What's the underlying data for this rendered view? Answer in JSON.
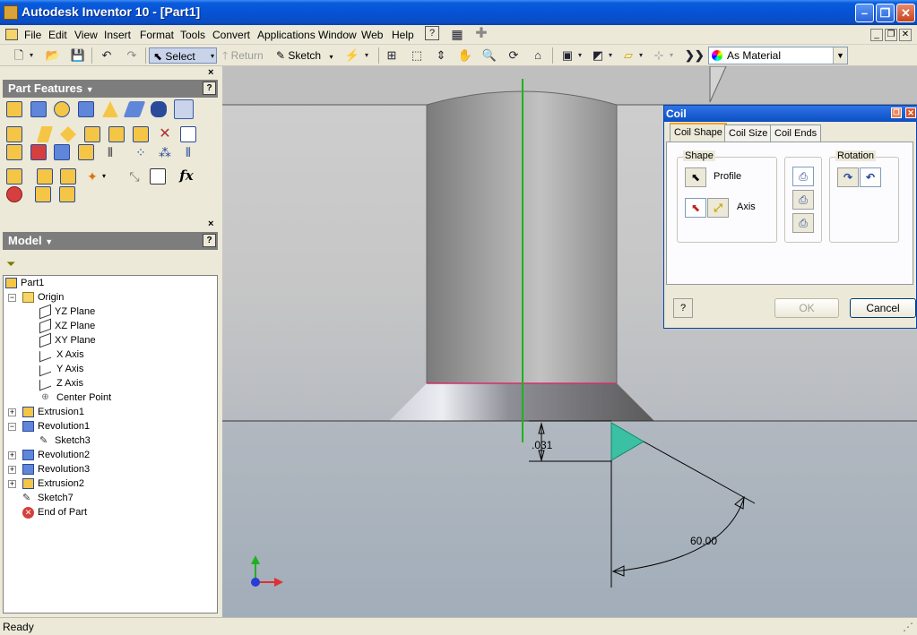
{
  "window": {
    "title": "Autodesk Inventor 10 - [Part1]",
    "minimize": "–",
    "restore": "❐",
    "close": "✕"
  },
  "menu": [
    "File",
    "Edit",
    "View",
    "Insert",
    "Format",
    "Tools",
    "Convert",
    "Applications",
    "Window",
    "Web",
    "Help"
  ],
  "toolbar": {
    "select_label": "Select",
    "return_label": "Return",
    "sketch_label": "Sketch",
    "material": "As Material"
  },
  "part_features": {
    "title": "Part Features",
    "close": "×",
    "help": "?"
  },
  "model": {
    "title": "Model",
    "close": "×",
    "help": "?",
    "tree": [
      {
        "label": "Part1"
      },
      {
        "label": "Origin"
      },
      {
        "label": "YZ Plane"
      },
      {
        "label": "XZ Plane"
      },
      {
        "label": "XY Plane"
      },
      {
        "label": "X Axis"
      },
      {
        "label": "Y Axis"
      },
      {
        "label": "Z Axis"
      },
      {
        "label": "Center Point"
      },
      {
        "label": "Extrusion1"
      },
      {
        "label": "Revolution1"
      },
      {
        "label": "Sketch3"
      },
      {
        "label": "Revolution2"
      },
      {
        "label": "Revolution3"
      },
      {
        "label": "Extrusion2"
      },
      {
        "label": "Sketch7"
      },
      {
        "label": "End of Part"
      }
    ]
  },
  "viewport": {
    "dim_vertical": ".031",
    "dim_angle": "60.00"
  },
  "coil_dialog": {
    "title": "Coil",
    "tabs": [
      "Coil Shape",
      "Coil Size",
      "Coil Ends"
    ],
    "active_tab": "Coil Shape",
    "shape_group": "Shape",
    "profile_label": "Profile",
    "axis_label": "Axis",
    "rotation_group": "Rotation",
    "ok": "OK",
    "cancel": "Cancel",
    "help": "?"
  },
  "status": {
    "text": "Ready"
  },
  "colors": {
    "title_blue": "#0653d6",
    "axis_green": "#1db31d",
    "profile_teal": "#3cc0a4",
    "edge_magenta": "#d0306c"
  }
}
